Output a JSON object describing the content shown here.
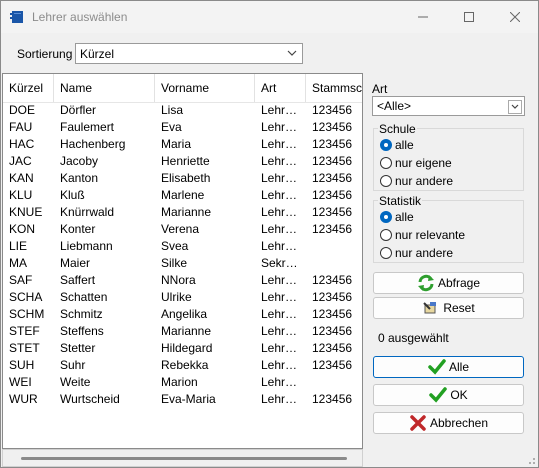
{
  "window": {
    "title": "Lehrer auswählen",
    "controls": [
      "minimize",
      "maximize",
      "close"
    ]
  },
  "sort": {
    "label": "Sortierung",
    "value": "Kürzel"
  },
  "table": {
    "columns": [
      "Kürzel",
      "Name",
      "Vorname",
      "Art",
      "Stammschule"
    ],
    "rows": [
      [
        "DOE",
        "Dörfler",
        "Lisa",
        "Lehr…",
        "123456"
      ],
      [
        "FAU",
        "Faulemert",
        "Eva",
        "Lehr…",
        "123456"
      ],
      [
        "HAC",
        "Hachenberg",
        "Maria",
        "Lehr…",
        "123456"
      ],
      [
        "JAC",
        "Jacoby",
        "Henriette",
        "Lehr…",
        "123456"
      ],
      [
        "KAN",
        "Kanton",
        "Elisabeth",
        "Lehr…",
        "123456"
      ],
      [
        "KLU",
        "Kluß",
        "Marlene",
        "Lehr…",
        "123456"
      ],
      [
        "KNUE",
        "Knürrwald",
        "Marianne",
        "Lehr…",
        "123456"
      ],
      [
        "KON",
        "Konter",
        "Verena",
        "Lehr…",
        "123456"
      ],
      [
        "LIE",
        "Liebmann",
        "Svea",
        "Lehr…",
        ""
      ],
      [
        "MA",
        "Maier",
        "Silke",
        "Sekr…",
        ""
      ],
      [
        "SAF",
        "Saffert",
        "NNora",
        "Lehr…",
        "123456"
      ],
      [
        "SCHA",
        "Schatten",
        "Ulrike",
        "Lehr…",
        "123456"
      ],
      [
        "SCHM",
        "Schmitz",
        "Angelika",
        "Lehr…",
        "123456"
      ],
      [
        "STEF",
        "Steffens",
        "Marianne",
        "Lehr…",
        "123456"
      ],
      [
        "STET",
        "Stetter",
        "Hildegard",
        "Lehr…",
        "123456"
      ],
      [
        "SUH",
        "Suhr",
        "Rebekka",
        "Lehr…",
        "123456"
      ],
      [
        "WEI",
        "Weite",
        "Marion",
        "Lehr…",
        ""
      ],
      [
        "WUR",
        "Wurtscheid",
        "Eva-Maria",
        "Lehr…",
        "123456"
      ]
    ]
  },
  "filter": {
    "art_label": "Art",
    "art_value": "<Alle>",
    "schule": {
      "title": "Schule",
      "options": [
        "alle",
        "nur eigene",
        "nur andere"
      ],
      "selected": 0
    },
    "statistik": {
      "title": "Statistik",
      "options": [
        "alle",
        "nur relevante",
        "nur andere"
      ],
      "selected": 0
    }
  },
  "buttons": {
    "abfrage": "Abfrage",
    "reset": "Reset",
    "alle": "Alle",
    "ok": "OK",
    "abbrechen": "Abbrechen"
  },
  "selection_info": "0 ausgewählt",
  "icons": [
    "window-app-icon",
    "refresh-icon",
    "reset-icon",
    "checkmark-icon",
    "cross-icon",
    "chevron-down-icon"
  ]
}
